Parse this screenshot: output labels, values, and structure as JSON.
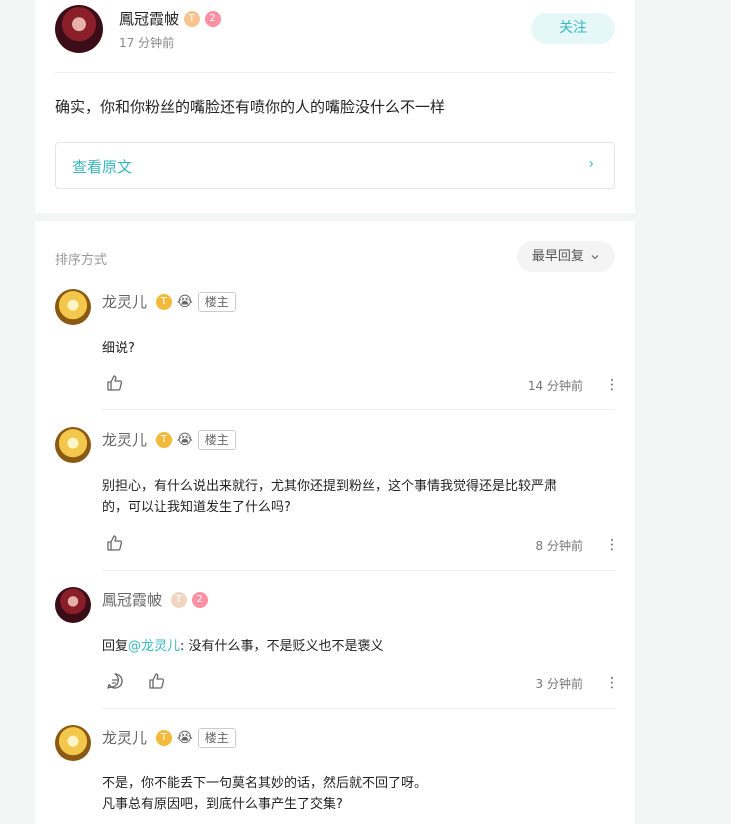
{
  "post": {
    "author": "鳳冠霞帔",
    "level_badge": "T",
    "number_badge": "2",
    "time": "17 分钟前",
    "follow_label": "关注",
    "content": "确实，你和你粉丝的嘴脸还有喷你的人的嘴脸没什么不一样",
    "view_original_label": "查看原文",
    "chevron": "›"
  },
  "comments_header": {
    "sort_label": "排序方式",
    "sort_value": "最早回复"
  },
  "comments": [
    {
      "author": "龙灵儿",
      "level_badge": "T",
      "emoji": "😭",
      "owner_tag": "楼主",
      "text": "细说?",
      "time": "14 分钟前"
    },
    {
      "author": "龙灵儿",
      "level_badge": "T",
      "emoji": "😭",
      "owner_tag": "楼主",
      "text_line1": "别担心，有什么说出来就行，尤其你还提到粉丝，这个事情我觉得还是比较严肃",
      "text_line2": "的，可以让我知道发生了什么吗?",
      "time": "8 分钟前"
    },
    {
      "author": "鳳冠霞帔",
      "level_badge": "T",
      "number_badge": "2",
      "reply_prefix": "回复",
      "mention": "@龙灵儿",
      "reply_text": ": 没有什么事，不是贬义也不是褒义",
      "time": "3 分钟前"
    },
    {
      "author": "龙灵儿",
      "level_badge": "T",
      "emoji": "😭",
      "owner_tag": "楼主",
      "text_line1": "不是，你不能丢下一句莫名其妙的话，然后就不回了呀。",
      "text_line2": "凡事总有原因吧，到底什么事产生了交集?"
    }
  ],
  "icons": {
    "more": "⋮"
  }
}
